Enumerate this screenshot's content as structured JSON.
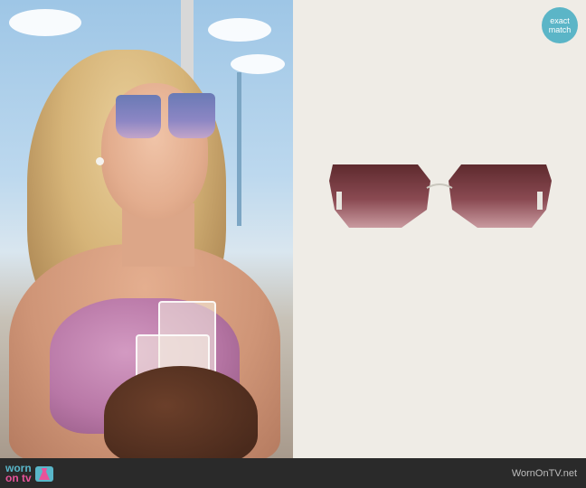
{
  "badge": {
    "line1": "exact",
    "line2": "match"
  },
  "logo": {
    "word1": "worn",
    "word2": "on tv"
  },
  "site": "WornOnTV.net",
  "colors": {
    "badge": "#5bb5c7",
    "logo_worn": "#59b6c9",
    "logo_ontv": "#e8539a",
    "bar": "#2a2a2a",
    "product_bg": "#efece6"
  }
}
